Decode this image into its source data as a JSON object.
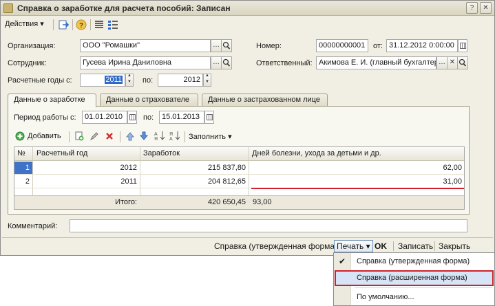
{
  "window": {
    "title": "Справка о заработке для расчета пособий: Записан"
  },
  "toolbar": {
    "actions_label": "Действия"
  },
  "form": {
    "org_label": "Организация:",
    "org_value": "ООО \"Ромашки\"",
    "employee_label": "Сотрудник:",
    "employee_value": "Гусева Ирина Даниловна",
    "years_label": "Расчетные годы с:",
    "year_from": "2011",
    "years_to_label": "по:",
    "year_to": "2012",
    "number_label": "Номер:",
    "number_value": "00000000001",
    "date_label": "от:",
    "date_value": "31.12.2012  0:00:00",
    "responsible_label": "Ответственный:",
    "responsible_value": "Акимова Е. И. (главный бухгалтер)"
  },
  "tabs": [
    {
      "label": "Данные о заработке"
    },
    {
      "label": "Данные о страхователе"
    },
    {
      "label": "Данные о застрахованном лице"
    }
  ],
  "period": {
    "label": "Период работы с:",
    "from": "01.01.2010",
    "to_label": "по:",
    "to": "15.01.2013"
  },
  "grid_toolbar": {
    "add_label": "Добавить",
    "fill_label": "Заполнить"
  },
  "table": {
    "columns": [
      "№",
      "Расчетный год",
      "Заработок",
      "Дней болезни, ухода за детьми и др."
    ],
    "rows": [
      [
        "1",
        "2012",
        "215 837,80",
        "62,00"
      ],
      [
        "2",
        "2011",
        "204 812,65",
        "31,00"
      ]
    ],
    "footer": {
      "label": "Итого:",
      "earnings": "420 650,45",
      "days": "93,00"
    }
  },
  "comment": {
    "label": "Комментарий:",
    "value": ""
  },
  "statusbar": {
    "report_label": "Справка (утвержденная форма)",
    "print_label": "Печать",
    "ok_label": "OK",
    "save_label": "Записать",
    "close_label": "Закрыть"
  },
  "print_menu": {
    "items": [
      {
        "label": "Справка (утвержденная форма)",
        "checked": true
      },
      {
        "label": "Справка (расширенная форма)",
        "highlighted": true
      },
      {
        "label": "По умолчанию..."
      }
    ]
  },
  "colors": {
    "highlight_border": "#d0202a",
    "selected_row": "#3f73c7"
  }
}
